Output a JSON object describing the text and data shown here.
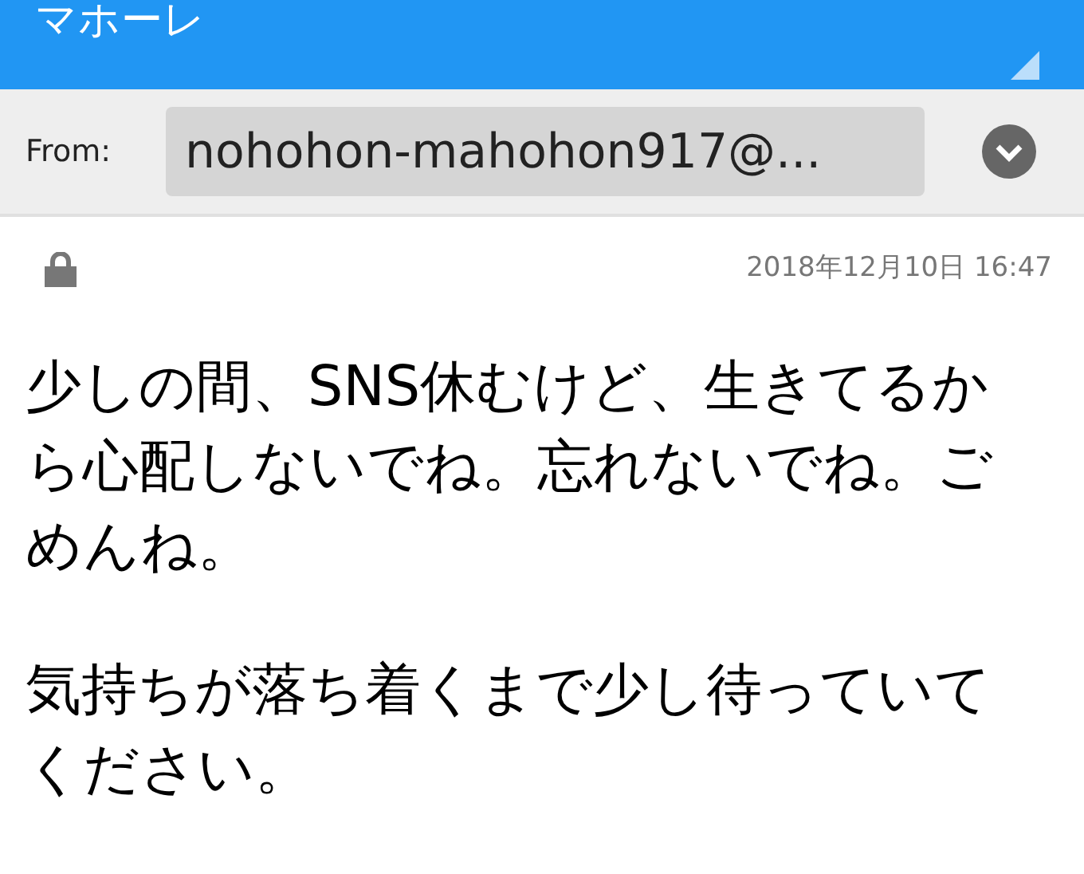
{
  "header": {
    "title": "マホーレ"
  },
  "from": {
    "label": "From:",
    "value": "nohohon-mahohon917@..."
  },
  "message": {
    "date": "2018年12月10日 16:47",
    "paragraphs": [
      "少しの間、SNS休むけど、生きてるから心配しないでね。忘れないでね。ごめんね。",
      "気持ちが落ち着くまで少し待っていてください。"
    ]
  }
}
